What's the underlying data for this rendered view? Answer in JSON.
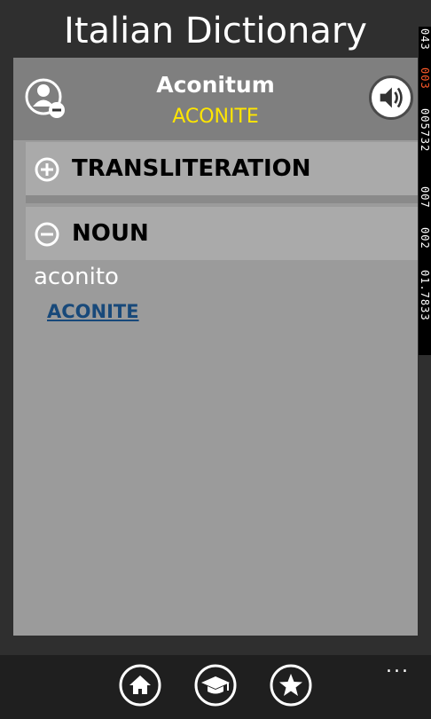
{
  "app": {
    "title": "Italian Dictionary"
  },
  "debug": {
    "values": [
      "043",
      "003",
      "005732",
      "007",
      "002",
      "01.7833"
    ]
  },
  "entry": {
    "word": "Aconitum",
    "translation": "ACONITE"
  },
  "sections": [
    {
      "label": "TRANSLITERATION",
      "state": "collapsed"
    },
    {
      "label": "NOUN",
      "state": "expanded"
    }
  ],
  "noun": {
    "meaning": "aconito",
    "link": "ACONITE"
  },
  "appbar": {
    "buttons": [
      "home-icon",
      "study-icon",
      "favorites-icon"
    ],
    "more_label": "..."
  },
  "colors": {
    "background": "#2f2f2f",
    "panel": "#9b9b9b",
    "header": "#7f7f7f",
    "section": "#aaaaaa",
    "translation": "#ffe600",
    "link": "#18497a"
  }
}
